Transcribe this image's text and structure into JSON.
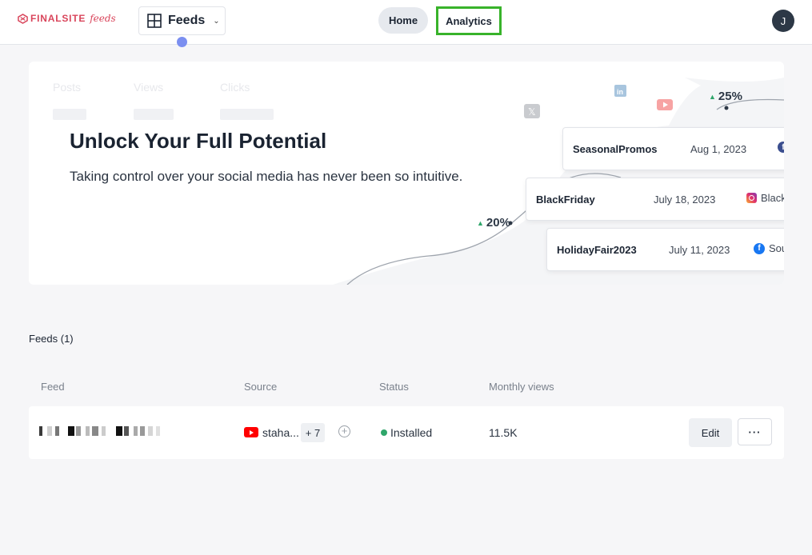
{
  "header": {
    "logo_brand": "FINALSITE",
    "logo_product": "feeds",
    "feeds_dropdown_label": "Feeds",
    "nav_home": "Home",
    "nav_analytics": "Analytics",
    "avatar_initial": "J"
  },
  "hero": {
    "ghost_labels": [
      "Posts",
      "Views",
      "Clicks"
    ],
    "title": "Unlock Your Full Potential",
    "subtitle": "Taking control over your social media has never been so intuitive.",
    "stat_upper": "25%",
    "stat_lower": "20%",
    "campaigns": [
      {
        "name": "SeasonalPromos",
        "date": "Aug 1, 2023",
        "source": ""
      },
      {
        "name": "BlackFriday",
        "date": "July 18, 2023",
        "source": "Black"
      },
      {
        "name": "HolidayFair2023",
        "date": "July 11, 2023",
        "source": "Sou"
      }
    ],
    "icons": [
      "linkedin-icon",
      "youtube-icon",
      "x-icon"
    ]
  },
  "feeds": {
    "section_title": "Feeds (1)",
    "columns": [
      "Feed",
      "Source",
      "Status",
      "Monthly views"
    ],
    "rows": [
      {
        "source_name": "staha...",
        "source_extra": "+ 7",
        "status": "Installed",
        "monthly_views": "11.5K",
        "edit_label": "Edit",
        "more_label": "···"
      }
    ]
  },
  "colors": {
    "accent_green_outline": "#38b32a",
    "status_green": "#2fa66a",
    "brand_red": "#d9455b",
    "youtube_red": "#ff0000",
    "notification_dot": "#7b8ff0"
  }
}
